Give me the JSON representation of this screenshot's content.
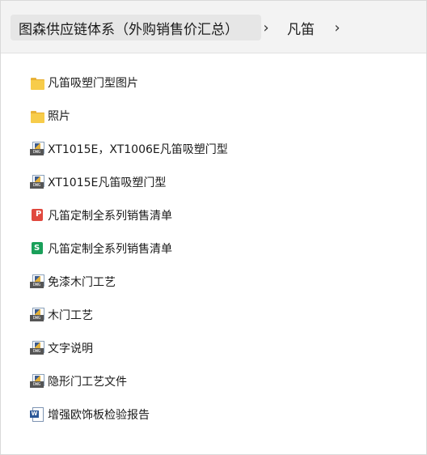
{
  "breadcrumb": {
    "items": [
      "图森供应链体系（外购销售价汇总）",
      "凡笛"
    ],
    "separator": "›"
  },
  "files": [
    {
      "name": "凡笛吸塑门型图片",
      "icon": "folder-icon"
    },
    {
      "name": "照片",
      "icon": "folder-icon"
    },
    {
      "name": "XT1015E，XT1006E凡笛吸塑门型",
      "icon": "dwg-file-icon"
    },
    {
      "name": "XT1015E凡笛吸塑门型",
      "icon": "dwg-file-icon"
    },
    {
      "name": "凡笛定制全系列销售清单",
      "icon": "pdf-app-icon"
    },
    {
      "name": "凡笛定制全系列销售清单",
      "icon": "spreadsheet-icon"
    },
    {
      "name": "免漆木门工艺",
      "icon": "dwg-file-icon"
    },
    {
      "name": "木门工艺",
      "icon": "dwg-file-icon"
    },
    {
      "name": "文字说明",
      "icon": "dwg-file-icon"
    },
    {
      "name": "隐形门工艺文件",
      "icon": "dwg-file-icon"
    },
    {
      "name": "增强欧饰板检验报告",
      "icon": "word-doc-icon"
    }
  ],
  "colors": {
    "folder": "#f7cc4a",
    "pdf_app": "#e0483e",
    "spreadsheet": "#1aa05a",
    "word": "#2b5797",
    "topbar_bg": "#f3f3f3"
  }
}
